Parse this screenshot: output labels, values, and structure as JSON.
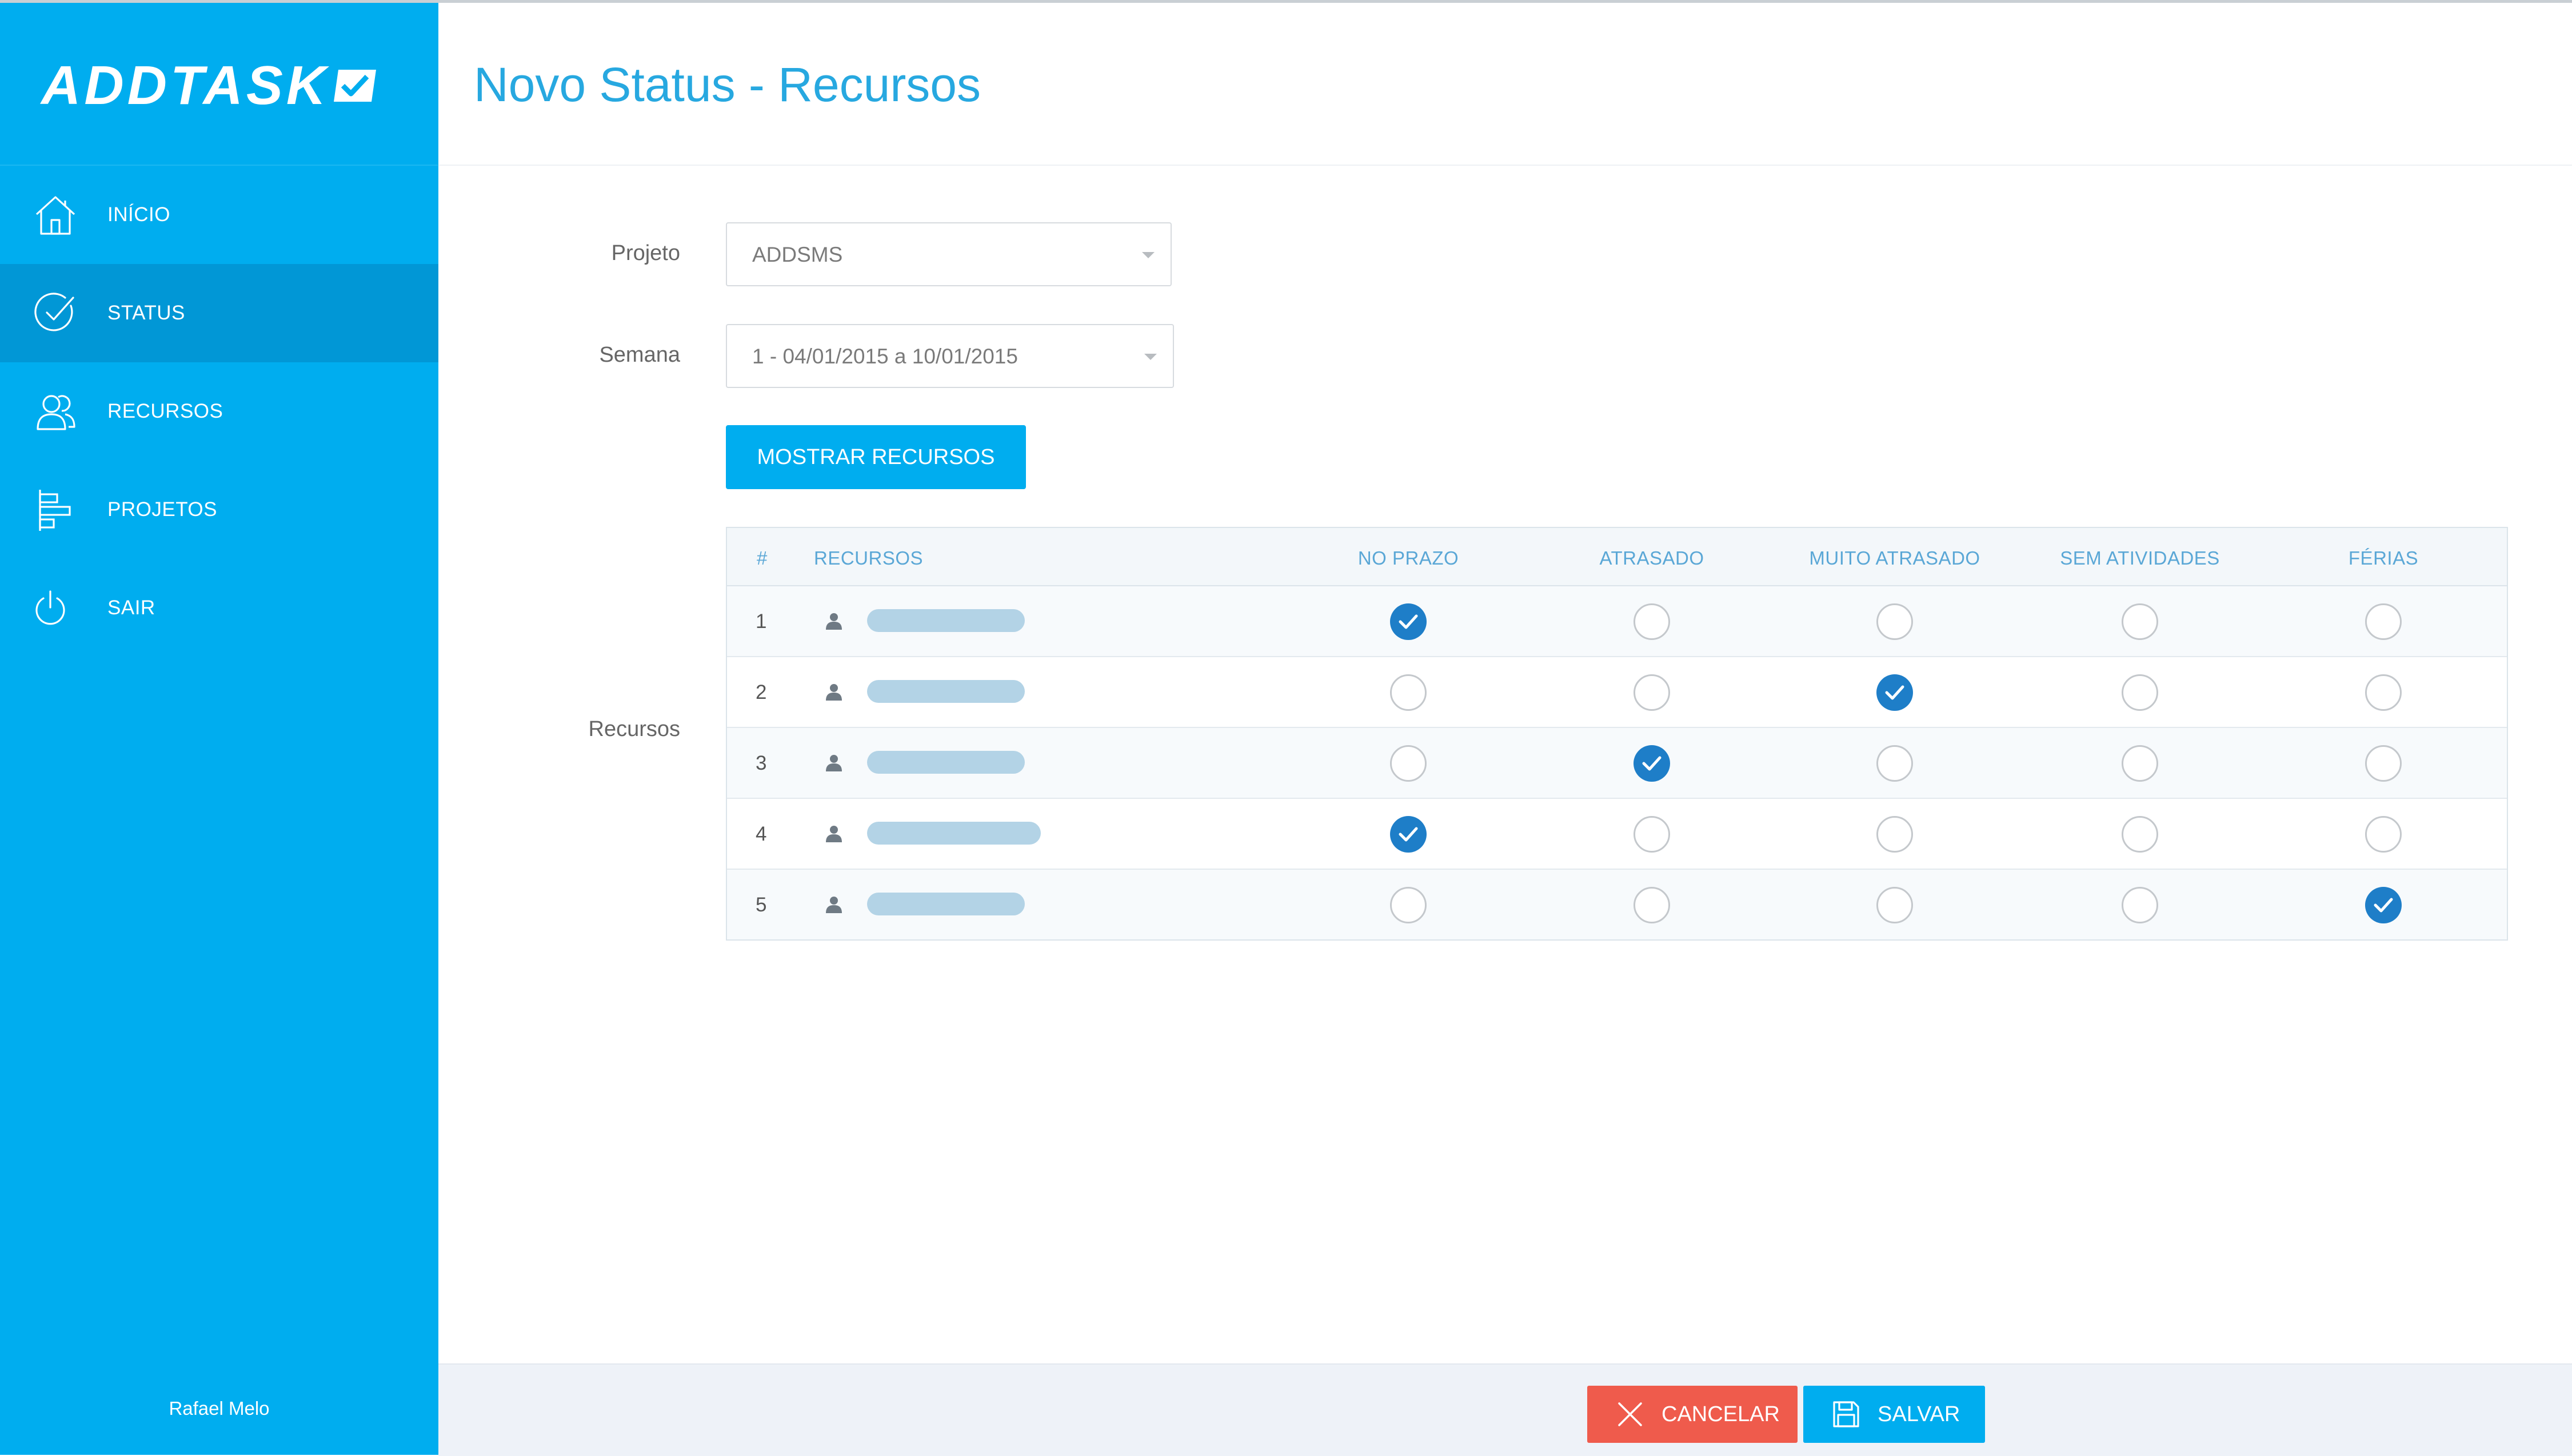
{
  "app": {
    "logo_text": "ADDTASK",
    "logo_icon": "check-box-icon"
  },
  "sidebar": {
    "items": [
      {
        "label": "INÍCIO",
        "icon": "home-icon"
      },
      {
        "label": "STATUS",
        "icon": "check-circle-icon",
        "active": true
      },
      {
        "label": "RECURSOS",
        "icon": "users-icon"
      },
      {
        "label": "PROJETOS",
        "icon": "projects-icon"
      },
      {
        "label": "SAIR",
        "icon": "power-icon"
      }
    ],
    "user_name": "Rafael Melo"
  },
  "header": {
    "title": "Novo Status - Recursos"
  },
  "form": {
    "projeto_label": "Projeto",
    "projeto_value": "ADDSMS",
    "semana_label": "Semana",
    "semana_value": "1 - 04/01/2015 a 10/01/2015",
    "show_button": "MOSTRAR RECURSOS",
    "recursos_label": "Recursos"
  },
  "table": {
    "columns": [
      "#",
      "RECURSOS",
      "NO PRAZO",
      "ATRASADO",
      "MUITO ATRASADO",
      "SEM ATIVIDADES",
      "FÉRIAS"
    ],
    "rows": [
      {
        "num": "1",
        "status": "NO PRAZO"
      },
      {
        "num": "2",
        "status": "MUITO ATRASADO"
      },
      {
        "num": "3",
        "status": "ATRASADO"
      },
      {
        "num": "4",
        "status": "NO PRAZO"
      },
      {
        "num": "5",
        "status": "FÉRIAS"
      }
    ]
  },
  "footer": {
    "cancel_label": "CANCELAR",
    "save_label": "SALVAR"
  },
  "colors": {
    "sidebar": "#00adef",
    "sidebar_active": "#0197d6",
    "accent": "#27a8e0",
    "radio_checked": "#1e7ec8",
    "cancel": "#ef5b4c"
  }
}
